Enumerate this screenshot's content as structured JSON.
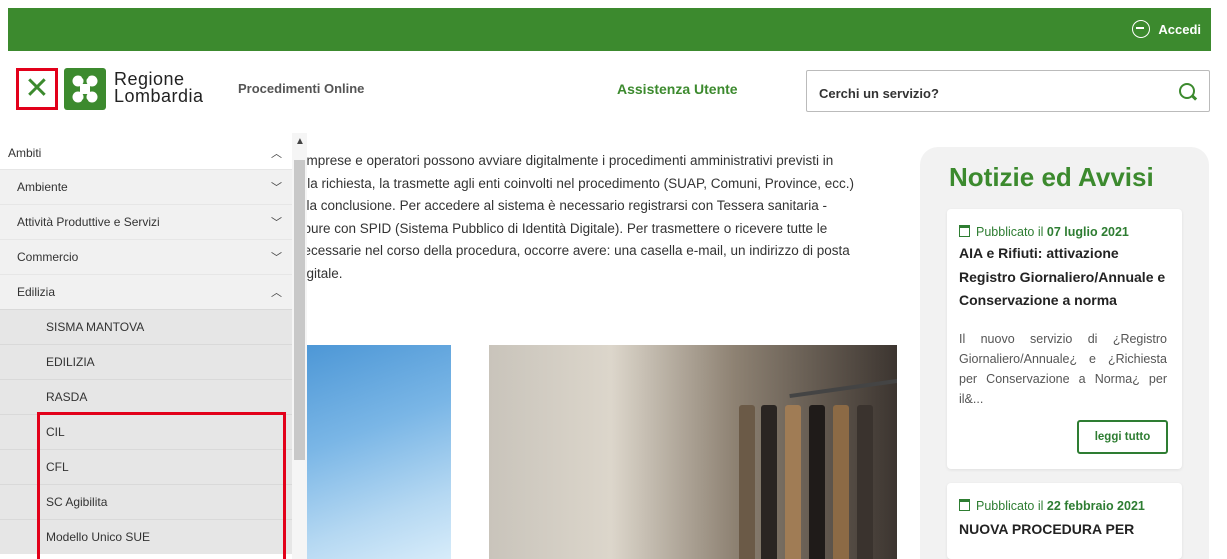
{
  "topbar": {
    "login_label": "Accedi"
  },
  "header": {
    "logo_line1": "Regione",
    "logo_line2": "Lombardia",
    "nav_procedimenti": "Procedimenti Online",
    "nav_assistenza": "Assistenza Utente",
    "search_placeholder": "Cerchi un servizio?"
  },
  "sidebar": {
    "root": "Ambiti",
    "items": [
      {
        "label": "Ambiente"
      },
      {
        "label": "Attività Produttive e Servizi"
      },
      {
        "label": "Commercio"
      },
      {
        "label": "Edilizia"
      }
    ],
    "subitems": [
      {
        "label": "SISMA MANTOVA"
      },
      {
        "label": "EDILIZIA"
      },
      {
        "label": "RASDA"
      },
      {
        "label": "CIL"
      },
      {
        "label": "CFL"
      },
      {
        "label": "SC Agibilita"
      },
      {
        "label": "Modello Unico SUE"
      }
    ]
  },
  "intro": {
    "lines": [
      ", imprese e operatori possono avviare digitalmente i procedimenti amministrativi previsti in",
      "e la richiesta, la trasmette agli enti coinvolti nel procedimento (SUAP, Comuni, Province, ecc.)",
      "alla conclusione. Per accedere al sistema è necessario registrarsi con Tessera sanitaria -",
      "ppure con SPID (Sistema Pubblico di Identità Digitale). Per trasmettere o ricevere tutte le",
      "necessarie nel corso della procedura, occorre avere: una casella e-mail, un indirizzo di posta",
      "digitale."
    ]
  },
  "news": {
    "title": "Notizie ed Avvisi",
    "cards": [
      {
        "published_prefix": "Pubblicato il",
        "date": "07 luglio 2021",
        "title": "AIA e Rifiuti: attivazione Registro Giornaliero/Annuale e Conservazione a norma",
        "body": "Il nuovo servizio di ¿Registro Giornaliero/Annuale¿ e ¿Richiesta per Conservazione a Norma¿ per il&...",
        "cta": "leggi tutto"
      },
      {
        "published_prefix": "Pubblicato il",
        "date": "22 febbraio 2021",
        "title": "NUOVA PROCEDURA PER"
      }
    ]
  },
  "colors": {
    "brand_green": "#3c8a2e",
    "highlight_red": "#e2001a"
  }
}
